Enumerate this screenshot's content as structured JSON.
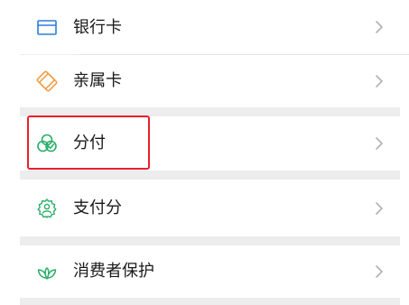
{
  "menu": {
    "items": [
      {
        "label": "银行卡",
        "icon": "bank-card-icon",
        "icon_color": "#2b7fd8"
      },
      {
        "label": "亲属卡",
        "icon": "family-card-icon",
        "icon_color": "#f0a04b"
      },
      {
        "label": "分付",
        "icon": "fenfu-icon",
        "icon_color": "#2aae67"
      },
      {
        "label": "支付分",
        "icon": "pay-score-icon",
        "icon_color": "#2aae67"
      },
      {
        "label": "消费者保护",
        "icon": "consumer-protection-icon",
        "icon_color": "#2aae67"
      }
    ],
    "chevron": "chevron-right-icon",
    "chevron_color": "#b2b2b2"
  },
  "annotation": {
    "highlight_color": "#e8202a",
    "highlighted_item": "分付"
  }
}
